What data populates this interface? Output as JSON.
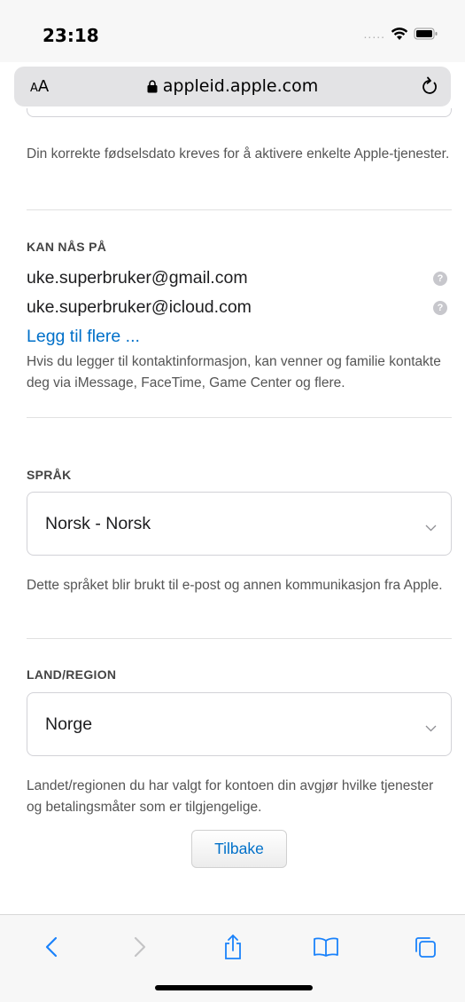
{
  "status_bar": {
    "time": "23:18",
    "signal": "....."
  },
  "address_bar": {
    "text_size_label_small": "A",
    "text_size_label_large": "A",
    "url": "appleid.apple.com"
  },
  "birthdate": {
    "help_text": "Din korrekte fødselsdato kreves for å aktivere enkelte Apple-tjenester."
  },
  "reachable_at": {
    "label": "KAN NÅS PÅ",
    "emails": [
      "uke.superbruker@gmail.com",
      "uke.superbruker@icloud.com"
    ],
    "add_more_link": "Legg til flere ...",
    "help_text": "Hvis du legger til kontaktinformasjon, kan venner og familie kontakte deg via iMessage, FaceTime, Game Center og flere."
  },
  "language": {
    "label": "SPRÅK",
    "selected": "Norsk - Norsk",
    "help_text": "Dette språket blir brukt til e-post og annen kommunikasjon fra Apple."
  },
  "country": {
    "label": "LAND/REGION",
    "selected": "Norge",
    "help_text": "Landet/regionen du har valgt for kontoen din avgjør hvilke tjenester og betalingsmåter som er tilgjengelige."
  },
  "back_button_label": "Tilbake",
  "toolbar": {
    "items": [
      "back-icon",
      "forward-icon",
      "share-icon",
      "bookmarks-icon",
      "tabs-icon"
    ]
  },
  "colors": {
    "link": "#0070c9",
    "toolbar_icon": "#1a82fb",
    "toolbar_icon_disabled": "#c4c4c6"
  }
}
